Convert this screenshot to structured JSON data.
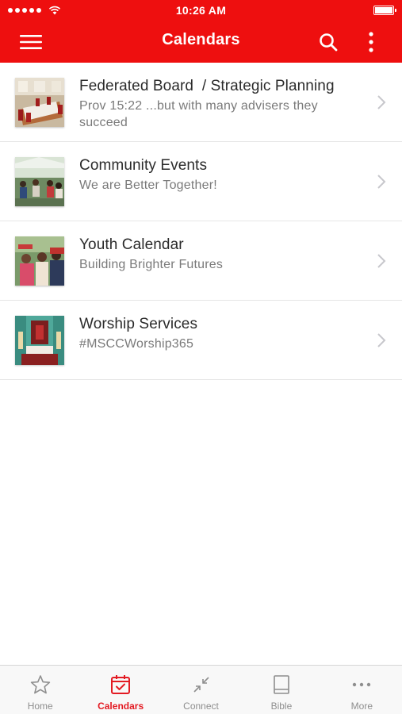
{
  "status_bar": {
    "time": "10:26 AM"
  },
  "nav": {
    "title": "Calendars"
  },
  "calendars": [
    {
      "title": "Federated Board  / Strategic Planning",
      "subtitle": "Prov 15:22 ...but with many advisers they succeed"
    },
    {
      "title": "Community Events",
      "subtitle": "We are Better Together!"
    },
    {
      "title": "Youth Calendar",
      "subtitle": "Building Brighter Futures"
    },
    {
      "title": "Worship Services",
      "subtitle": "#MSCCWorship365"
    }
  ],
  "tabs": [
    {
      "label": "Home",
      "icon": "star-icon",
      "active": false
    },
    {
      "label": "Calendars",
      "icon": "calendar-icon",
      "active": true
    },
    {
      "label": "Connect",
      "icon": "collapse-arrows-icon",
      "active": false
    },
    {
      "label": "Bible",
      "icon": "book-icon",
      "active": false
    },
    {
      "label": "More",
      "icon": "ellipsis-icon",
      "active": false
    }
  ],
  "colors": {
    "brand": "#ee0f0f",
    "active_tab": "#e31b23",
    "inactive_tab": "#8e8e8e"
  }
}
